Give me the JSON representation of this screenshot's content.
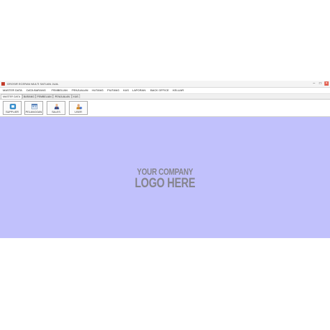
{
  "window": {
    "title": "GROSIR ECERAN MULTI SATUAN JUAL",
    "controls": [
      "–",
      "□",
      "✕"
    ]
  },
  "menu": {
    "items": [
      "MASTER DATA",
      "DATA BARANG",
      "PEMBELIAN",
      "PENJUALAN",
      "HUTANG",
      "PIUTANG",
      "KAS",
      "LAPORAN",
      "BACK OFFICE",
      "KELUAR"
    ]
  },
  "tabs": {
    "items": [
      "MASTER DATA",
      "BARANG",
      "PEMBELIAN",
      "PENJUALAN",
      "KAS"
    ],
    "active": "MASTER DATA"
  },
  "toolbar": {
    "buttons": [
      {
        "label": "SUPPLIER",
        "icon": "supplier-icon"
      },
      {
        "label": "PELANGGAN",
        "icon": "customer-icon"
      },
      {
        "label": "SALES",
        "icon": "sales-person-icon"
      },
      {
        "label": "USER",
        "icon": "user-icon"
      }
    ]
  },
  "content": {
    "background": "#c1c1fc",
    "logo_line1": "YOUR COMPANY",
    "logo_line2": "LOGO HERE"
  },
  "colors": {
    "close_button": "#e25c4c",
    "logo_text": "#86858e"
  }
}
